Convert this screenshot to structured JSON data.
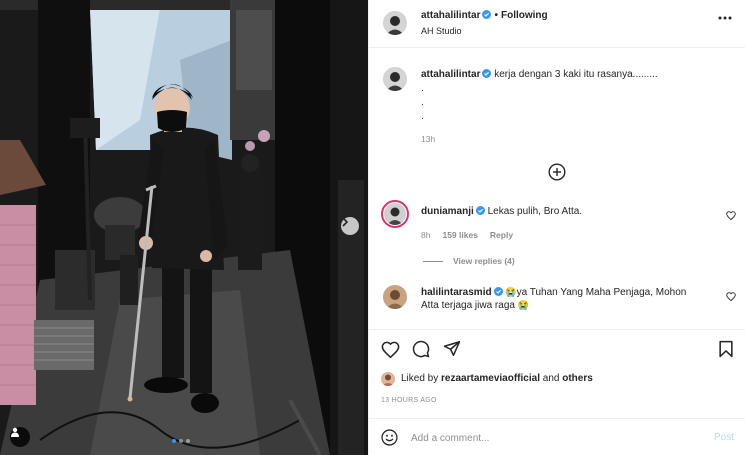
{
  "post": {
    "author": "attahalilintar",
    "follow_status": "Following",
    "location": "AH Studio",
    "header_separator": "•"
  },
  "caption": {
    "username": "attahalilintar",
    "text": "kerja dengan 3 kaki itu rasanya.........",
    "extra_lines": [
      ".",
      ".",
      "."
    ],
    "time": "13h"
  },
  "comments": [
    {
      "username": "duniamanji",
      "text": "Lekas pulih, Bro Atta.",
      "time": "8h",
      "likes": "159 likes",
      "reply_label": "Reply",
      "view_replies": "View replies (4)"
    },
    {
      "username": "halilintarasmid",
      "text_line1": "ya Tuhan Yang Maha Penjaga, Mohon",
      "text_line2": "Atta terjaga jiwa raga",
      "emoji_1": "😭",
      "emoji_2": "😭"
    }
  ],
  "likes": {
    "prefix": "Liked by",
    "user": "rezaartameviaofficial",
    "conjunction": "and",
    "others": "others"
  },
  "timestamp": "13 HOURS AGO",
  "add_comment": {
    "placeholder": "Add a comment...",
    "post_label": "Post"
  },
  "carousel": {
    "total": 3,
    "active_index": 0
  },
  "icons": {
    "verified": "verified-badge-icon",
    "more": "more-options-icon",
    "load_more": "plus-circle-icon",
    "like": "heart-icon",
    "comment": "comment-icon",
    "share": "share-icon",
    "save": "bookmark-icon",
    "emoji": "emoji-icon",
    "next": "chevron-right-icon",
    "tags": "user-tag-icon"
  },
  "colors": {
    "accent": "#3897f0",
    "post_disabled": "#b3dbff",
    "muted": "#8e8e8e"
  }
}
